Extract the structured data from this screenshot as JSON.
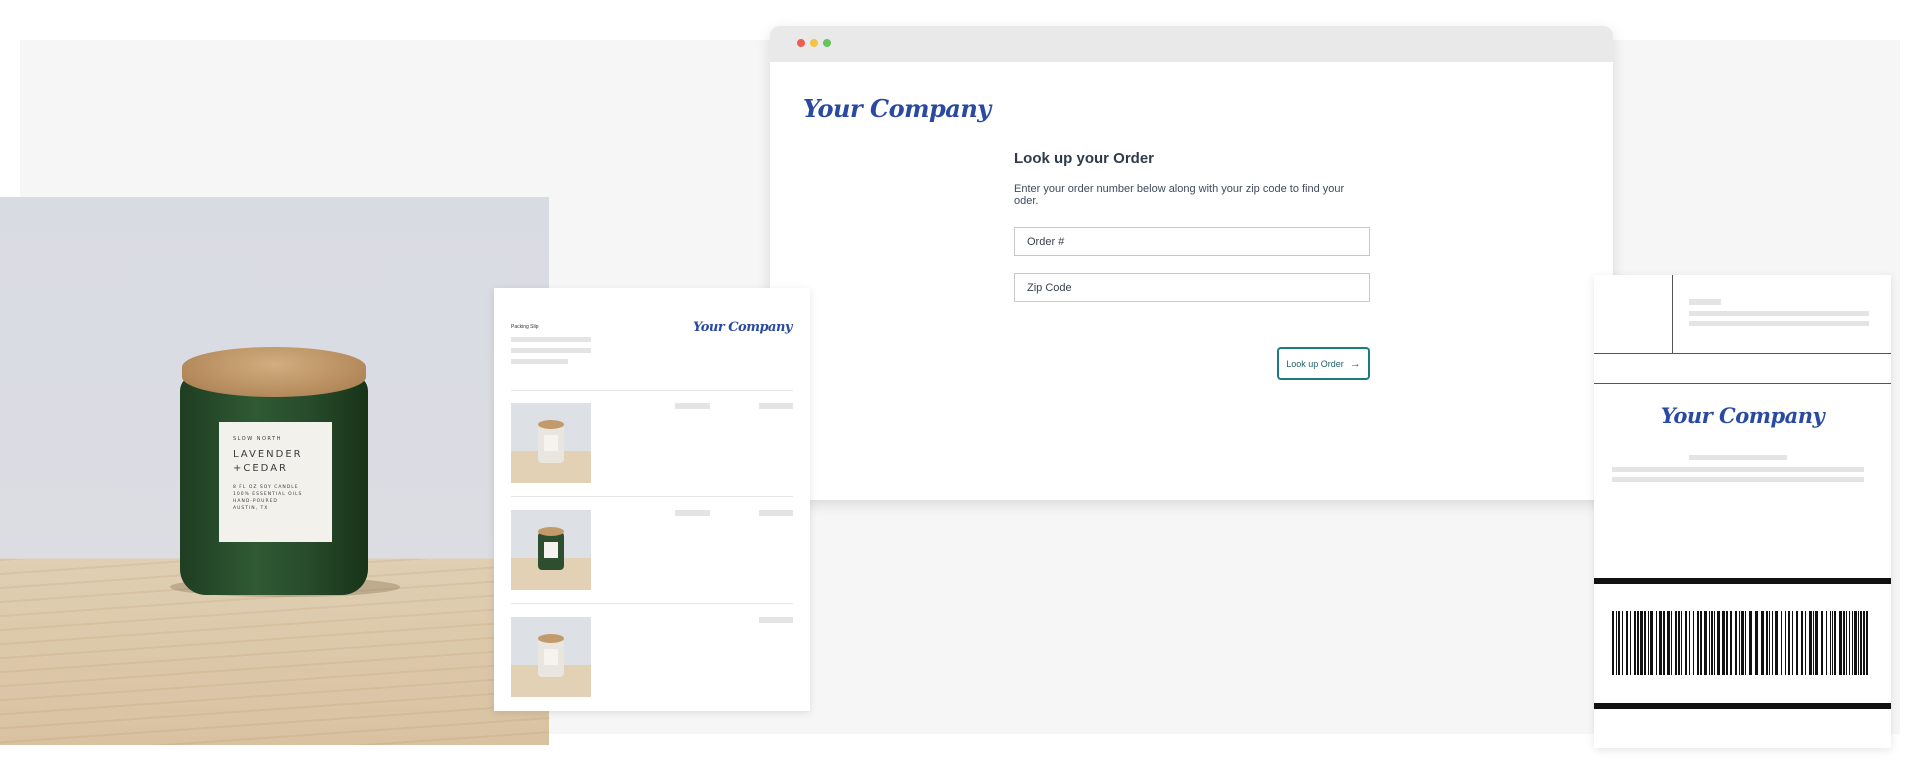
{
  "lookup_page": {
    "logo_text": "Your Company",
    "heading": "Look up your Order",
    "description": "Enter your order number below along with your zip code to find your oder.",
    "order_field_placeholder": "Order #",
    "zip_field_placeholder": "Zip Code",
    "submit_label": "Look up Order"
  },
  "product_photo": {
    "label_brand": "SLOW NORTH",
    "label_name_1": "LAVENDER",
    "label_name_2": "+CEDAR",
    "label_detail_1": "8 FL OZ SOY CANDLE",
    "label_detail_2": "100% ESSENTIAL OILS",
    "label_detail_3": "HAND-POURED",
    "label_detail_4": "AUSTIN, TX"
  },
  "packing_slip": {
    "title": "Packing Slip",
    "logo_text": "Your Company"
  },
  "shipping_label": {
    "logo_text": "Your Company"
  },
  "colors": {
    "brand_blue": "#2a4aa2",
    "button_teal": "#1f7a80",
    "backdrop": "#f6f6f6"
  }
}
